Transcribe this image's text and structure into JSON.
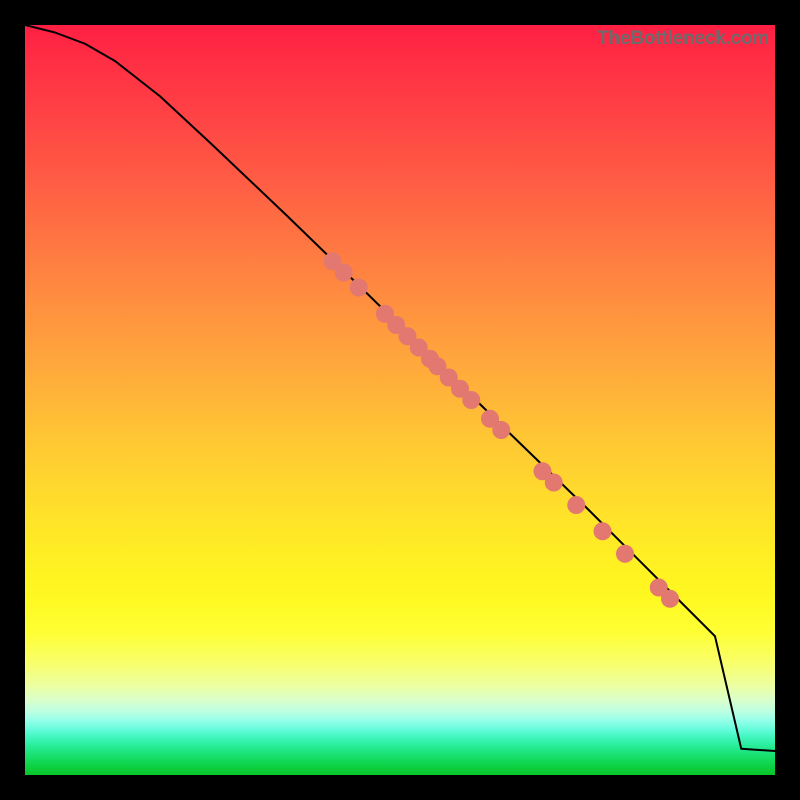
{
  "watermark": "TheBottleneck.com",
  "chart_data": {
    "type": "line",
    "title": "",
    "xlabel": "",
    "ylabel": "",
    "xlim": [
      0,
      100
    ],
    "ylim": [
      0,
      100
    ],
    "grid": false,
    "series": [
      {
        "name": "curve",
        "x": [
          0,
          4,
          8,
          12,
          18,
          25,
          35,
          45,
          55,
          65,
          75,
          85,
          92,
          95.5,
          100
        ],
        "values": [
          100,
          99,
          97.5,
          95.2,
          90.5,
          84,
          74.5,
          64.8,
          55,
          45.2,
          35.5,
          25.5,
          18.5,
          3.5,
          3.2
        ]
      }
    ],
    "points": {
      "name": "markers",
      "color": "#e2786f",
      "x": [
        41,
        42.5,
        44.5,
        48,
        49.5,
        51,
        52.5,
        54,
        55,
        56.5,
        58,
        59.5,
        62,
        63.5,
        69,
        70.5,
        73.5,
        77,
        80,
        84.5,
        86
      ],
      "y": [
        68.5,
        67,
        65,
        61.5,
        60,
        58.5,
        57,
        55.5,
        54.5,
        53,
        51.5,
        50,
        47.5,
        46,
        40.5,
        39,
        36,
        32.5,
        29.5,
        25,
        23.5
      ]
    }
  }
}
